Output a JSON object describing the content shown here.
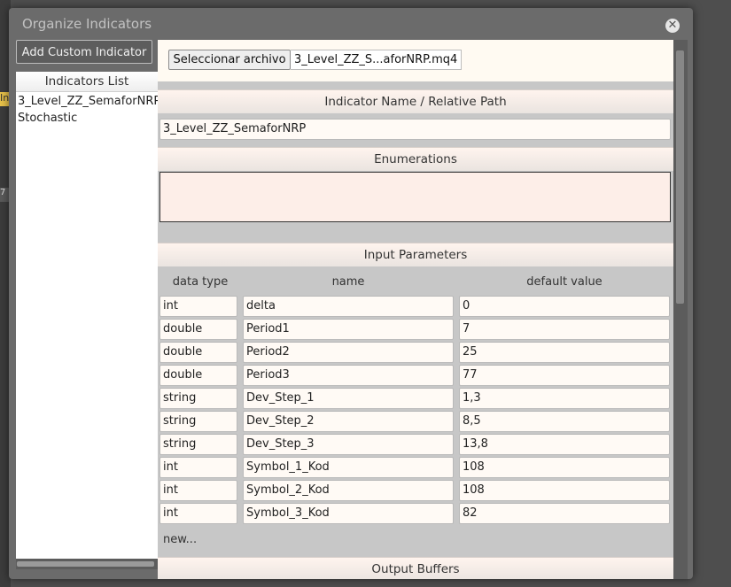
{
  "window": {
    "title": "Organize Indicators"
  },
  "toolbar": {
    "add_custom_label": "Add Custom Indicator"
  },
  "indicators_list": {
    "header": "Indicators List",
    "items": [
      "3_Level_ZZ_SemaforNRP",
      "Stochastic"
    ]
  },
  "file": {
    "button_label": "Seleccionar archivo",
    "file_name": "3_Level_ZZ_S...aforNRP.mq4"
  },
  "sections": {
    "name_path": "Indicator Name / Relative Path",
    "enumerations": "Enumerations",
    "input_parameters": "Input Parameters",
    "output_buffers": "Output Buffers"
  },
  "indicator_path_value": "3_Level_ZZ_SemaforNRP",
  "params": {
    "columns": [
      "data type",
      "name",
      "default value"
    ],
    "rows": [
      {
        "type": "int",
        "name": "delta",
        "value": "0"
      },
      {
        "type": "double",
        "name": "Period1",
        "value": "7"
      },
      {
        "type": "double",
        "name": "Period2",
        "value": "25"
      },
      {
        "type": "double",
        "name": "Period3",
        "value": "77"
      },
      {
        "type": "string",
        "name": "Dev_Step_1",
        "value": "1,3"
      },
      {
        "type": "string",
        "name": "Dev_Step_2",
        "value": "8,5"
      },
      {
        "type": "string",
        "name": "Dev_Step_3",
        "value": "13,8"
      },
      {
        "type": "int",
        "name": "Symbol_1_Kod",
        "value": "108"
      },
      {
        "type": "int",
        "name": "Symbol_2_Kod",
        "value": "108"
      },
      {
        "type": "int",
        "name": "Symbol_3_Kod",
        "value": "82"
      }
    ],
    "new_label": "new..."
  },
  "background": {
    "tag_text": "In",
    "tag2_text": "7"
  }
}
